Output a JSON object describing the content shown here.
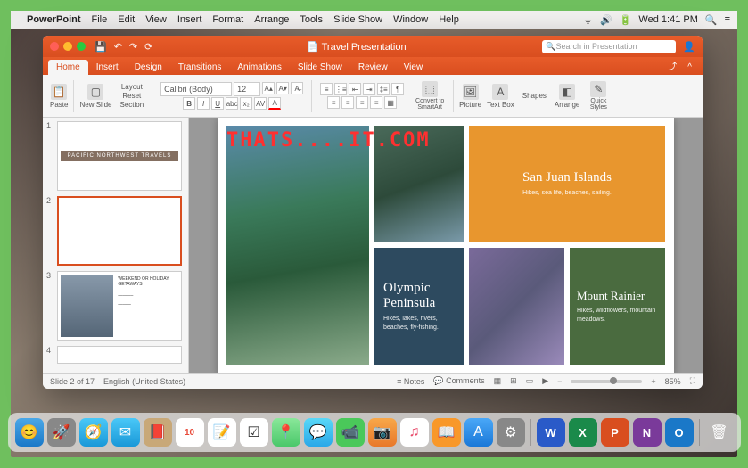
{
  "menubar": {
    "app": "PowerPoint",
    "items": [
      "File",
      "Edit",
      "View",
      "Insert",
      "Format",
      "Arrange",
      "Tools",
      "Slide Show",
      "Window",
      "Help"
    ],
    "clock": "Wed 1:41 PM"
  },
  "window": {
    "doc_title": "Travel Presentation",
    "search_placeholder": "Search in Presentation"
  },
  "tabs": [
    "Home",
    "Insert",
    "Design",
    "Transitions",
    "Animations",
    "Slide Show",
    "Review",
    "View"
  ],
  "ribbon": {
    "paste": "Paste",
    "new_slide": "New Slide",
    "layout": "Layout",
    "reset": "Reset",
    "section": "Section",
    "font": "Calibri (Body)",
    "size": "12",
    "convert": "Convert to SmartArt",
    "picture": "Picture",
    "textbox": "Text Box",
    "shapes": "Shapes",
    "arrange": "Arrange",
    "quick_styles": "Quick Styles"
  },
  "thumbs": {
    "t1_title": "PACIFIC NORTHWEST TRAVELS",
    "t3_title": "WEEKEND OR HOLIDAY GETAWAYS"
  },
  "slide": {
    "sanjuan_title": "San Juan Islands",
    "sanjuan_sub": "Hikes, sea life, beaches, sailing.",
    "olympic_title": "Olympic Peninsula",
    "olympic_sub": "Hikes, lakes, rivers, beaches, fly-fishing.",
    "rainier_title": "Mount Rainier",
    "rainier_sub": "Hikes, wildflowers, mountain meadows.",
    "watermark": "THATS....IT.COM"
  },
  "statusbar": {
    "slide_info": "Slide 2 of 17",
    "lang": "English (United States)",
    "notes": "Notes",
    "comments": "Comments",
    "zoom": "85%"
  },
  "dock_items": [
    "Finder",
    "Launchpad",
    "Safari",
    "Mail",
    "Contacts",
    "Calendar",
    "Notes",
    "Reminders",
    "Maps",
    "Messages",
    "FaceTime",
    "PhotoBooth",
    "iTunes",
    "iBooks",
    "AppStore",
    "Preferences",
    "Word",
    "Excel",
    "PowerPoint",
    "OneNote",
    "Outlook",
    "Trash"
  ]
}
